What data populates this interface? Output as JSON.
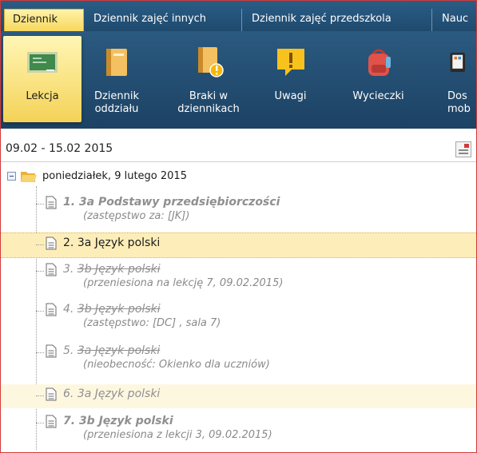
{
  "tabs": [
    {
      "label": "Dziennik",
      "active": true
    },
    {
      "label": "Dziennik zajęć innych",
      "active": false
    },
    {
      "label": "Dziennik zajęć przedszkola",
      "active": false
    },
    {
      "label": "Nauc",
      "active": false
    }
  ],
  "ribbon": [
    {
      "label": "Lekcja",
      "icon": "blackboard-icon",
      "active": true
    },
    {
      "label": "Dziennik oddziału",
      "icon": "book-icon",
      "active": false
    },
    {
      "label": "Braki w dziennikach",
      "icon": "book-warning-icon",
      "active": false
    },
    {
      "label": "Uwagi",
      "icon": "note-warning-icon",
      "active": false
    },
    {
      "label": "Wycieczki",
      "icon": "backpack-icon",
      "active": false
    },
    {
      "label": "Dos mob",
      "icon": "mobile-icon",
      "active": false
    }
  ],
  "date_range": "09.02 - 15.02 2015",
  "tree": {
    "day_label": "poniedziałek, 9 lutego 2015",
    "lessons": [
      {
        "number": "1.",
        "title": "3a Podstawy przedsiębiorczości",
        "note": "(zastępstwo za: [JK])",
        "style": "muted-bold"
      },
      {
        "number": "2.",
        "title": "3a Język polski",
        "note": "",
        "style": "selected"
      },
      {
        "number": "3.",
        "title": "3b Język polski",
        "note": "(przeniesiona na lekcję 7, 09.02.2015)",
        "style": "struck"
      },
      {
        "number": "4.",
        "title": "3b Język polski",
        "note": "(zastępstwo: [DC] , sala  7)",
        "style": "struck"
      },
      {
        "number": "5.",
        "title": "3a Język polski",
        "note": "(nieobecność: Okienko dla uczniów)",
        "style": "struck"
      },
      {
        "number": "6.",
        "title": "3a Język polski",
        "note": "",
        "style": "muted-highlight"
      },
      {
        "number": "7.",
        "title": "3b Język polski",
        "note": "(przeniesiona z lekcji 3, 09.02.2015)",
        "style": "muted-bold"
      }
    ]
  },
  "colors": {
    "ribbon_blue": "#1f4a6e",
    "active_yellow": "#f6d75e",
    "selected_row": "#fdeeb9",
    "frame_red": "#d33a3a"
  }
}
